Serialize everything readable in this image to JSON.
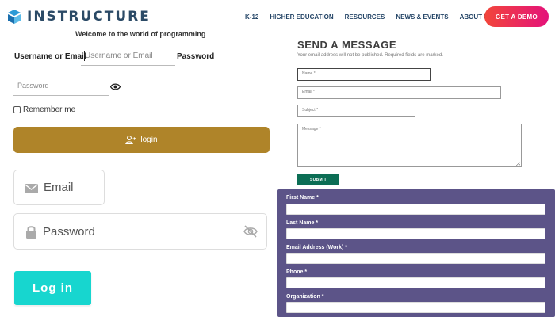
{
  "header": {
    "logo_text": "INSTRUCTURE",
    "nav": [
      "K-12",
      "HIGHER EDUCATION",
      "RESOURCES",
      "NEWS & EVENTS",
      "ABOUT US"
    ],
    "cta_label": "GET A DEMO"
  },
  "login1": {
    "welcome": "Welcome to the world of programming",
    "username_label": "Username or Email",
    "username_placeholder": "Username or Email",
    "password_label": "Password",
    "password_placeholder": "Password",
    "remember_label": "Remember me",
    "login_label": "login"
  },
  "login2": {
    "email_label": "Email",
    "password_label": "Password",
    "login_label": "Log in"
  },
  "message_form": {
    "title": "SEND A MESSAGE",
    "note": "Your email address will not be published. Required fields are marked.",
    "name_placeholder": "Name *",
    "email_placeholder": "Email *",
    "subject_placeholder": "Subject *",
    "message_placeholder": "Message *",
    "submit_label": "SUBMIT"
  },
  "purple_form": {
    "fields": [
      "First Name *",
      "Last Name *",
      "Email Address (Work) *",
      "Phone *",
      "Organization *"
    ]
  },
  "colors": {
    "gold_button": "#af8429",
    "teal_button": "#17d6cf",
    "submit_green": "#0c6e55",
    "form_purple": "#5c5488",
    "demo_gradient_start": "#f2463a",
    "demo_gradient_end": "#e4127a",
    "brand_navy": "#2b4a66"
  },
  "icons": {
    "logo": "instructure-logo-icon",
    "show_password": "eye-icon",
    "login": "user-login-icon",
    "email": "envelope-icon",
    "password": "lock-icon",
    "hide_password": "eye-off-icon"
  }
}
